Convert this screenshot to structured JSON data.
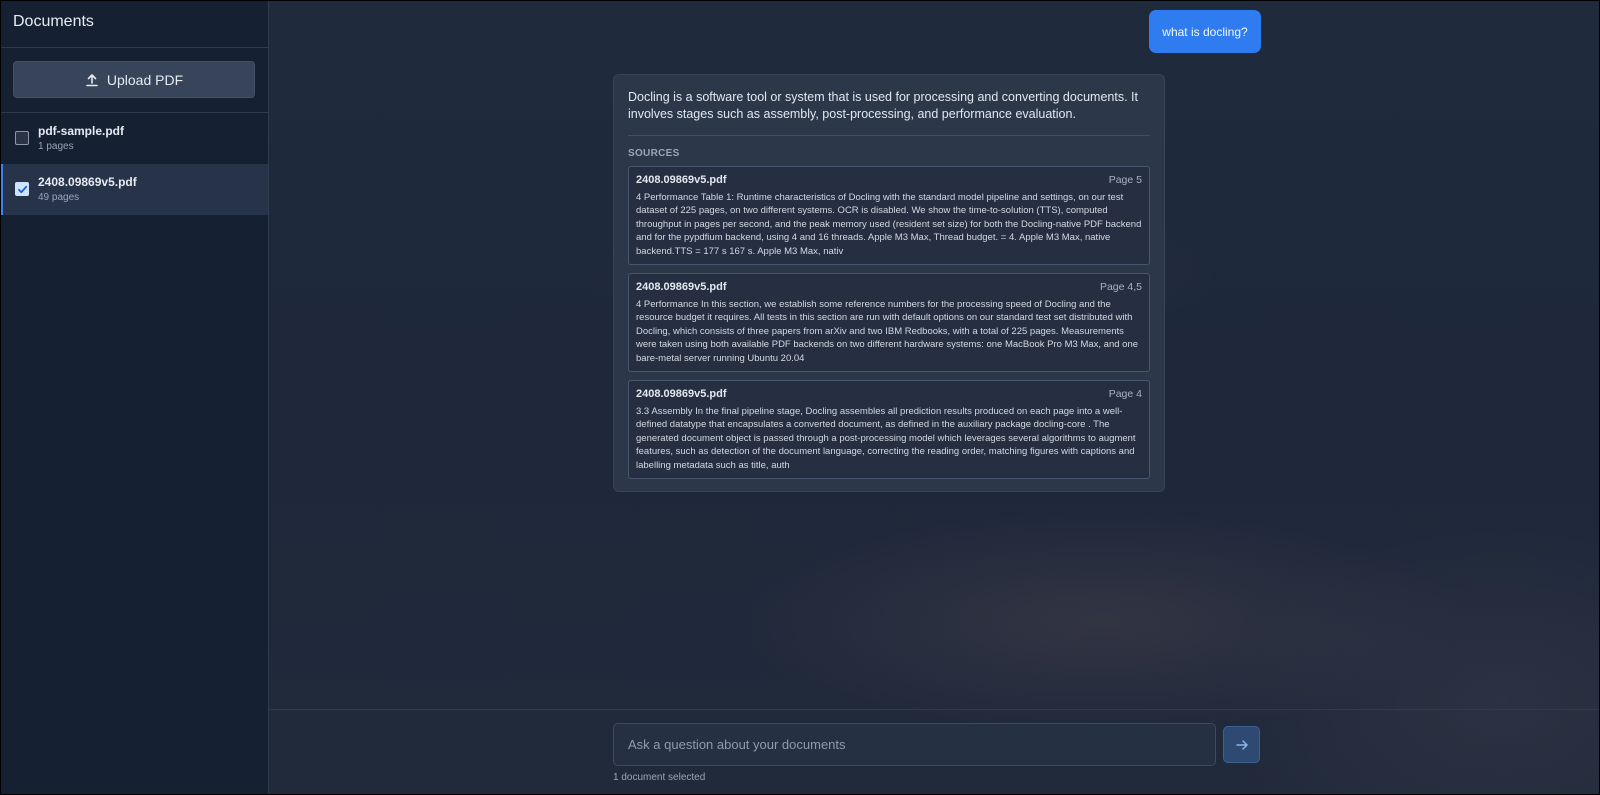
{
  "sidebar": {
    "title": "Documents",
    "upload_label": "Upload PDF",
    "documents": [
      {
        "name": "pdf-sample.pdf",
        "pages": "1 pages",
        "checked": false
      },
      {
        "name": "2408.09869v5.pdf",
        "pages": "49 pages",
        "checked": true
      }
    ]
  },
  "chat": {
    "user_message": "what is docling?",
    "answer": "Docling is a software tool or system that is used for processing and converting documents. It involves stages such as assembly, post-processing, and performance evaluation.",
    "sources_label": "SOURCES",
    "sources": [
      {
        "file": "2408.09869v5.pdf",
        "page": "Page 5",
        "excerpt": "4 Performance Table 1: Runtime characteristics of Docling with the standard model pipeline and settings, on our test dataset of 225 pages, on two different systems. OCR is disabled. We show the time-to-solution (TTS), computed throughput in pages per second, and the peak memory used (resident set size) for both the Docling-native PDF backend and for the pypdfium backend, using 4 and 16 threads. Apple M3 Max, Thread budget. = 4. Apple M3 Max, native backend.TTS = 177 s 167 s. Apple M3 Max, nativ"
      },
      {
        "file": "2408.09869v5.pdf",
        "page": "Page 4,5",
        "excerpt": "4 Performance In this section, we establish some reference numbers for the processing speed of Docling and the resource budget it requires. All tests in this section are run with default options on our standard test set distributed with Docling, which consists of three papers from arXiv and two IBM Redbooks, with a total of 225 pages. Measurements were taken using both available PDF backends on two different hardware systems: one MacBook Pro M3 Max, and one bare-metal server running Ubuntu 20.04"
      },
      {
        "file": "2408.09869v5.pdf",
        "page": "Page 4",
        "excerpt": "3.3 Assembly In the final pipeline stage, Docling assembles all prediction results produced on each page into a well-defined datatype that encapsulates a converted document, as defined in the auxiliary package docling-core . The generated document object is passed through a post-processing model which leverages several algorithms to augment features, such as detection of the document language, correcting the reading order, matching figures with captions and labelling metadata such as title, auth"
      }
    ]
  },
  "composer": {
    "placeholder": "Ask a question about your documents",
    "value": "",
    "selection_status": "1 document selected"
  },
  "colors": {
    "accent": "#2f7cf0",
    "sidebar_bg": "#152033",
    "card_bg": "#2c374a"
  },
  "icons": {
    "upload": "upload-icon",
    "checkbox_checked": "check-icon",
    "send": "arrow-right-icon"
  }
}
